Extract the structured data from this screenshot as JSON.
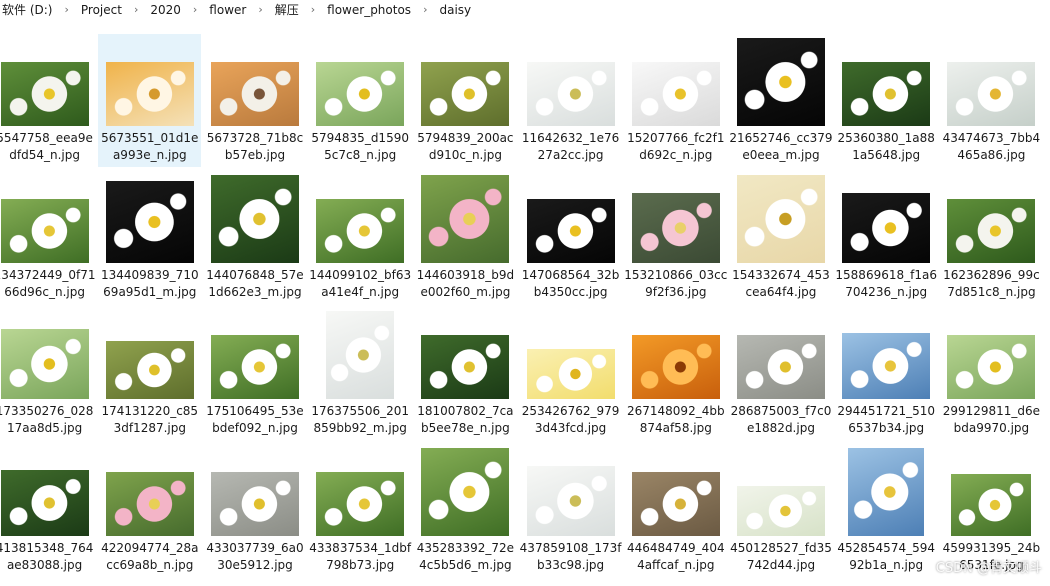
{
  "breadcrumb": [
    "软件 (D:)",
    "Project",
    "2020",
    "flower",
    "解压",
    "flower_photos",
    "daisy"
  ],
  "watermark": "CSDN @青文顺斗",
  "files": [
    {
      "name": "5547758_eea9edfd54_n.jpg",
      "thumb": "green-dark"
    },
    {
      "name": "5673551_01d1ea993e_n.jpg",
      "thumb": "orange-light"
    },
    {
      "name": "5673728_71b8cb57eb.jpg",
      "thumb": "orange"
    },
    {
      "name": "5794835_d15905c7c8_n.jpg",
      "thumb": "green-light"
    },
    {
      "name": "5794839_200acd910c_n.jpg",
      "thumb": "olive"
    },
    {
      "name": "11642632_1e7627a2cc.jpg",
      "thumb": "white"
    },
    {
      "name": "15207766_fc2f1d692c_n.jpg",
      "thumb": "white-yellow"
    },
    {
      "name": "21652746_cc379e0eea_m.jpg",
      "thumb": "black"
    },
    {
      "name": "25360380_1a881a5648.jpg",
      "thumb": "dark-green"
    },
    {
      "name": "43474673_7bb4465a86.jpg",
      "thumb": "pale"
    },
    {
      "name": "134372449_0f7166d96c_n.jpg",
      "thumb": "grass"
    },
    {
      "name": "134409839_71069a95d1_m.jpg",
      "thumb": "black"
    },
    {
      "name": "144076848_57e1d662e3_m.jpg",
      "thumb": "dark-green"
    },
    {
      "name": "144099102_bf63a41e4f_n.jpg",
      "thumb": "grass"
    },
    {
      "name": "144603918_b9de002f60_m.jpg",
      "thumb": "pink-green"
    },
    {
      "name": "147068564_32bb4350cc.jpg",
      "thumb": "black"
    },
    {
      "name": "153210866_03cc9f2f36.jpg",
      "thumb": "pink"
    },
    {
      "name": "154332674_453cea64f4.jpg",
      "thumb": "yellow"
    },
    {
      "name": "158869618_f1a6704236_n.jpg",
      "thumb": "black"
    },
    {
      "name": "162362896_99c7d851c8_n.jpg",
      "thumb": "green-dark"
    },
    {
      "name": "173350276_02817aa8d5.jpg",
      "thumb": "green-light"
    },
    {
      "name": "174131220_c853df1287.jpg",
      "thumb": "olive"
    },
    {
      "name": "175106495_53ebdef092_n.jpg",
      "thumb": "grass"
    },
    {
      "name": "176375506_201859bb92_m.jpg",
      "thumb": "white"
    },
    {
      "name": "181007802_7cab5ee78e_n.jpg",
      "thumb": "dark-green"
    },
    {
      "name": "253426762_9793d43fcd.jpg",
      "thumb": "yellow-white"
    },
    {
      "name": "267148092_4bb874af58.jpg",
      "thumb": "sunset"
    },
    {
      "name": "286875003_f7c0e1882d.jpg",
      "thumb": "gray"
    },
    {
      "name": "294451721_5106537b34.jpg",
      "thumb": "sky"
    },
    {
      "name": "299129811_d6ebda9970.jpg",
      "thumb": "green-light"
    },
    {
      "name": "413815348_764ae83088.jpg",
      "thumb": "dark-green"
    },
    {
      "name": "422094774_28acc69a8b_n.jpg",
      "thumb": "pink-green"
    },
    {
      "name": "433037739_6a030e5912.jpg",
      "thumb": "gray"
    },
    {
      "name": "433837534_1dbf798b73.jpg",
      "thumb": "grass"
    },
    {
      "name": "435283392_72e4c5b5d6_m.jpg",
      "thumb": "grass"
    },
    {
      "name": "437859108_173fb33c98.jpg",
      "thumb": "white"
    },
    {
      "name": "446484749_4044affcaf_n.jpg",
      "thumb": "brown"
    },
    {
      "name": "450128527_fd35742d44.jpg",
      "thumb": "white-green"
    },
    {
      "name": "452854574_59492b1a_n.jpg",
      "thumb": "sky"
    },
    {
      "name": "459931395_24b6531fe.jpg",
      "thumb": "grass"
    }
  ],
  "selected_index": 1,
  "colors": {
    "selected_bg": "#e5f3fb",
    "text": "#1a1a1a",
    "separator": "#6b6b6b"
  }
}
